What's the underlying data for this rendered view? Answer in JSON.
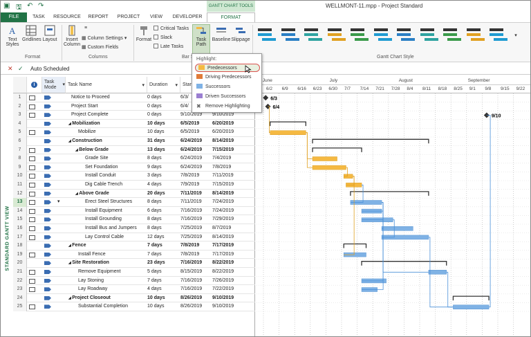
{
  "titlebar": {
    "context_tab": "GANTT CHART TOOLS",
    "document_title": "WELLMONT-11.mpp - Project Standard"
  },
  "tabs": [
    "FILE",
    "TASK",
    "RESOURCE",
    "REPORT",
    "PROJECT",
    "VIEW",
    "DEVELOPER",
    "FORMAT"
  ],
  "ribbon": {
    "text_styles": "Text Styles",
    "gridlines": "Gridlines",
    "layout": "Layout",
    "insert_column": "Insert Column",
    "column_settings": "Column Settings",
    "custom_fields": "Custom Fields",
    "format": "Format",
    "critical_tasks": "Critical Tasks",
    "slack": "Slack",
    "late_tasks": "Late Tasks",
    "task_path": "Task Path",
    "baseline": "Baseline",
    "slippage": "Slippage",
    "group_format": "Format",
    "group_columns": "Columns",
    "group_bar": "Bar S",
    "group_gantt_style": "Gantt Chart Style",
    "style_colors": [
      "#1f9bd1",
      "#2a7fc4",
      "#2ea3a0",
      "#e0a020",
      "#3a9a4a",
      "#1f9bd1",
      "#2a7fc4",
      "#2ea3a0",
      "#3a9a4a",
      "#e0a020",
      "#1f9bd1"
    ]
  },
  "dropdown": {
    "heading": "Highlight:",
    "items": [
      "Predecessors",
      "Driving Predecessors",
      "Successors",
      "Driven Successors",
      "Remove Highlighting"
    ]
  },
  "formula_bar": {
    "value": "Auto Scheduled"
  },
  "side_label": "STANDARD GANTT VIEW",
  "columns": {
    "task_mode": "Task Mode",
    "task_name": "Task Name",
    "duration": "Duration",
    "start": "Start"
  },
  "tasks": [
    {
      "id": "1",
      "name": "Notice to Proceed",
      "dur": "0 days",
      "start": "6/3/",
      "finish": "",
      "indent": 0,
      "summary": false
    },
    {
      "id": "2",
      "name": "Project Start",
      "dur": "0 days",
      "start": "6/4/",
      "finish": "",
      "indent": 0,
      "summary": false
    },
    {
      "id": "3",
      "name": "Project Complete",
      "dur": "0 days",
      "start": "9/10/2019",
      "finish": "9/10/2019",
      "indent": 0,
      "summary": false
    },
    {
      "id": "4",
      "name": "Mobilization",
      "dur": "10 days",
      "start": "6/5/2019",
      "finish": "6/20/2019",
      "indent": 0,
      "summary": true
    },
    {
      "id": "5",
      "name": "Mobilize",
      "dur": "10 days",
      "start": "6/5/2019",
      "finish": "6/20/2019",
      "indent": 1,
      "summary": false
    },
    {
      "id": "6",
      "name": "Construction",
      "dur": "31 days",
      "start": "6/24/2019",
      "finish": "8/14/2019",
      "indent": 0,
      "summary": true
    },
    {
      "id": "7",
      "name": "Below Grade",
      "dur": "13 days",
      "start": "6/24/2019",
      "finish": "7/15/2019",
      "indent": 1,
      "summary": true
    },
    {
      "id": "8",
      "name": "Grade Site",
      "dur": "8 days",
      "start": "6/24/2019",
      "finish": "7/4/2019",
      "indent": 2,
      "summary": false
    },
    {
      "id": "9",
      "name": "Set Foundation",
      "dur": "9 days",
      "start": "6/24/2019",
      "finish": "7/8/2019",
      "indent": 2,
      "summary": false
    },
    {
      "id": "10",
      "name": "Install Conduit",
      "dur": "3 days",
      "start": "7/8/2019",
      "finish": "7/11/2019",
      "indent": 2,
      "summary": false
    },
    {
      "id": "11",
      "name": "Dig Cable Trench",
      "dur": "4 days",
      "start": "7/9/2019",
      "finish": "7/15/2019",
      "indent": 2,
      "summary": false
    },
    {
      "id": "12",
      "name": "Above Grade",
      "dur": "20 days",
      "start": "7/11/2019",
      "finish": "8/14/2019",
      "indent": 1,
      "summary": true
    },
    {
      "id": "13",
      "name": "Erect Steel Structures",
      "dur": "8 days",
      "start": "7/11/2019",
      "finish": "7/24/2019",
      "indent": 2,
      "summary": false
    },
    {
      "id": "14",
      "name": "Install Equipment",
      "dur": "6 days",
      "start": "7/16/2019",
      "finish": "7/24/2019",
      "indent": 2,
      "summary": false
    },
    {
      "id": "15",
      "name": "Install Grounding",
      "dur": "8 days",
      "start": "7/16/2019",
      "finish": "7/29/2019",
      "indent": 2,
      "summary": false
    },
    {
      "id": "16",
      "name": "Install Bus and Jumpers",
      "dur": "8 days",
      "start": "7/25/2019",
      "finish": "8/7/2019",
      "indent": 2,
      "summary": false
    },
    {
      "id": "17",
      "name": "Lay Control Cable",
      "dur": "12 days",
      "start": "7/25/2019",
      "finish": "8/14/2019",
      "indent": 2,
      "summary": false
    },
    {
      "id": "18",
      "name": "Fence",
      "dur": "7 days",
      "start": "7/8/2019",
      "finish": "7/17/2019",
      "indent": 0,
      "summary": true
    },
    {
      "id": "19",
      "name": "Install Fence",
      "dur": "7 days",
      "start": "7/8/2019",
      "finish": "7/17/2019",
      "indent": 1,
      "summary": false
    },
    {
      "id": "20",
      "name": "Site Restoration",
      "dur": "23 days",
      "start": "7/16/2019",
      "finish": "8/22/2019",
      "indent": 0,
      "summary": true
    },
    {
      "id": "21",
      "name": "Remove Equipment",
      "dur": "5 days",
      "start": "8/15/2019",
      "finish": "8/22/2019",
      "indent": 1,
      "summary": false
    },
    {
      "id": "22",
      "name": "Lay Stoning",
      "dur": "7 days",
      "start": "7/16/2019",
      "finish": "7/26/2019",
      "indent": 1,
      "summary": false
    },
    {
      "id": "23",
      "name": "Lay Roadway",
      "dur": "4 days",
      "start": "7/16/2019",
      "finish": "7/22/2019",
      "indent": 1,
      "summary": false
    },
    {
      "id": "24",
      "name": "Project Closeout",
      "dur": "10 days",
      "start": "8/26/2019",
      "finish": "9/10/2019",
      "indent": 0,
      "summary": true
    },
    {
      "id": "25",
      "name": "Substantial Completion",
      "dur": "10 days",
      "start": "8/26/2019",
      "finish": "9/10/2019",
      "indent": 1,
      "summary": false
    }
  ],
  "timeline": {
    "months": [
      "June",
      "July",
      "August",
      "September"
    ],
    "weeks": [
      "6/2",
      "6/9",
      "6/16",
      "6/23",
      "6/30",
      "7/7",
      "7/14",
      "7/21",
      "7/28",
      "8/4",
      "8/11",
      "8/18",
      "8/25",
      "9/1",
      "9/8",
      "9/15",
      "9/22"
    ],
    "milestone_labels": [
      "6/3",
      "6/4",
      "9/10"
    ]
  },
  "colors": {
    "accent": "#217346",
    "bar": "#7fb2e5",
    "highlight_bar": "#f5b942",
    "summary": "#333333",
    "link": "#4a90d9"
  }
}
